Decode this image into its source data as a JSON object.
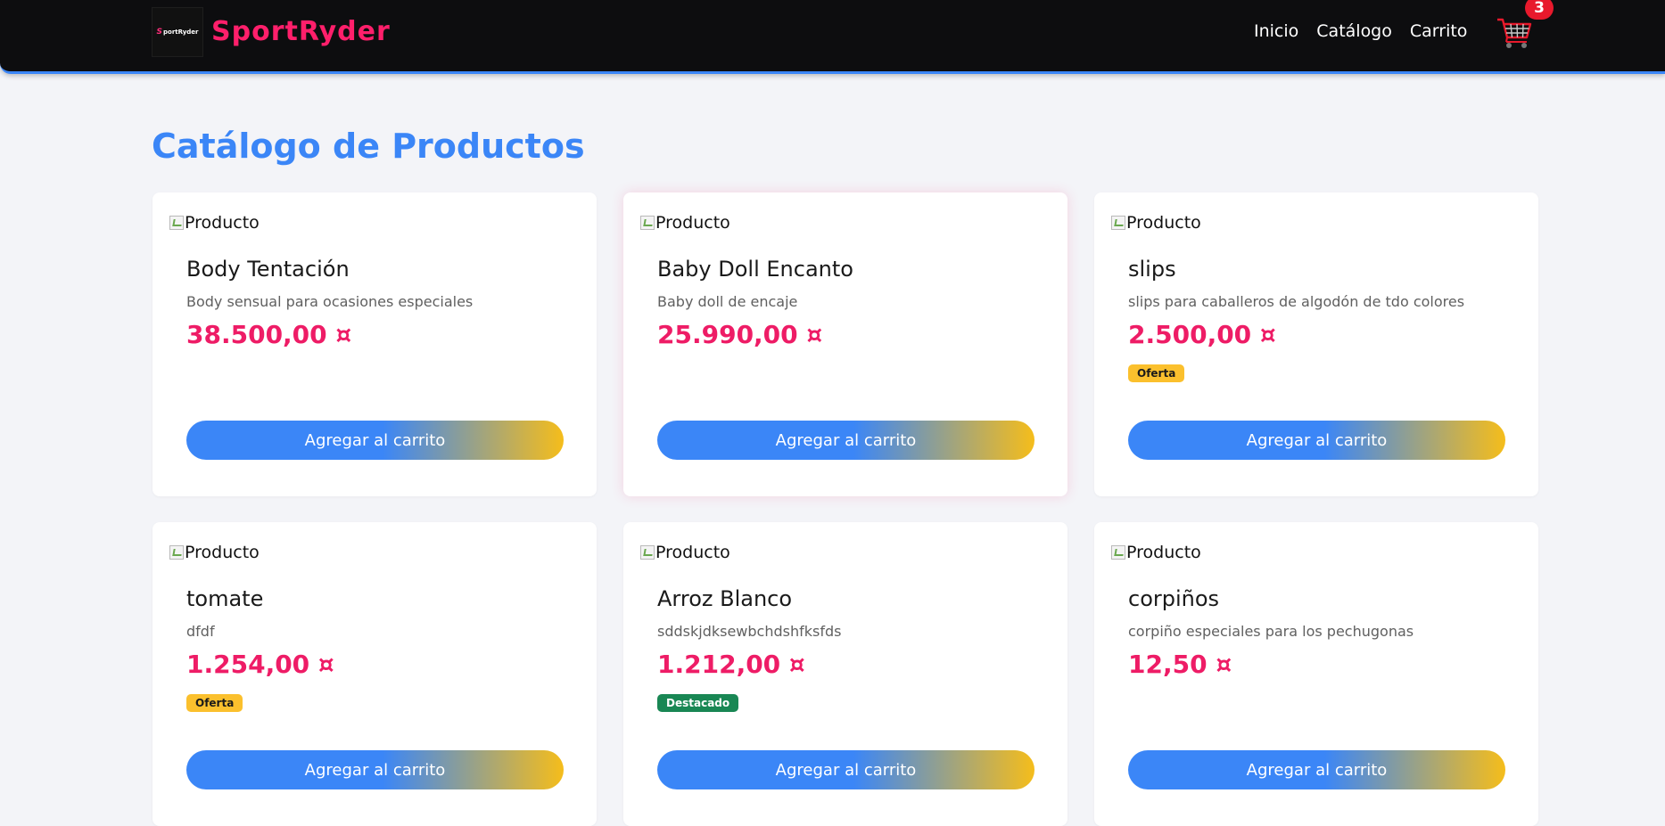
{
  "header": {
    "brand": "SportRyder",
    "logo_text_a": "S",
    "logo_text_b": "portRyder",
    "nav": [
      {
        "label": "Inicio"
      },
      {
        "label": "Catálogo"
      },
      {
        "label": "Carrito"
      }
    ],
    "cart_count": "3",
    "cart_icon": "shopping-cart-icon"
  },
  "main": {
    "title": "Catálogo de Productos",
    "products": [
      {
        "img_alt": "Producto",
        "name": "Body Tentación",
        "description": "Body sensual para ocasiones especiales",
        "price": "38.500,00 ¤",
        "badge": "",
        "button": "Agregar al carrito"
      },
      {
        "img_alt": "Producto",
        "name": "Baby Doll Encanto",
        "description": "Baby doll de encaje",
        "price": "25.990,00 ¤",
        "badge": "",
        "button": "Agregar al carrito"
      },
      {
        "img_alt": "Producto",
        "name": "slips",
        "description": "slips para caballeros de algodón de tdo colores",
        "price": "2.500,00 ¤",
        "badge": "Oferta",
        "button": "Agregar al carrito"
      },
      {
        "img_alt": "Producto",
        "name": "tomate",
        "description": "dfdf",
        "price": "1.254,00 ¤",
        "badge": "Oferta",
        "button": "Agregar al carrito"
      },
      {
        "img_alt": "Producto",
        "name": "Arroz Blanco",
        "description": "sddskjdksewbchdshfksfds",
        "price": "1.212,00 ¤",
        "badge": "Destacado",
        "button": "Agregar al carrito"
      },
      {
        "img_alt": "Producto",
        "name": "corpiños",
        "description": "corpiño especiales para los pechugonas",
        "price": "12,50 ¤",
        "badge": "",
        "button": "Agregar al carrito"
      }
    ]
  },
  "colors": {
    "brand": "#ff1f6b",
    "accent": "#3b86f7",
    "price": "#ee1c66",
    "oferta": "#fbc02d",
    "destacado": "#198754"
  }
}
